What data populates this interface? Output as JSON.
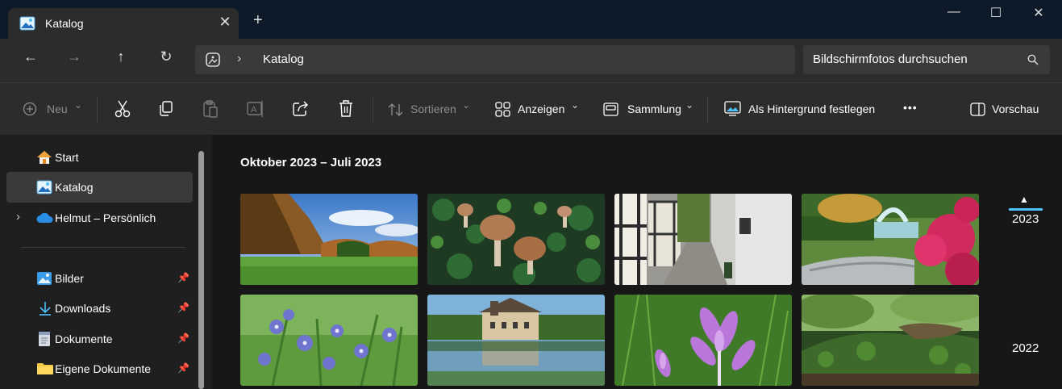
{
  "window": {
    "tab_title": "Katalog",
    "tab_close": "✕",
    "new_tab": "+",
    "minimize": "—",
    "maximize": "☐",
    "close": "✕"
  },
  "address": {
    "back": "←",
    "forward": "→",
    "up": "↑",
    "refresh": "↻",
    "separator": "›",
    "breadcrumb": "Katalog",
    "search_placeholder": "Bildschirmfotos durchsuchen",
    "search_icon": "search-icon"
  },
  "toolbar": {
    "new_label": "Neu",
    "sort_label": "Sortieren",
    "view_label": "Anzeigen",
    "collection_label": "Sammlung",
    "set_background_label": "Als Hintergrund festlegen",
    "more_label": "•••",
    "preview_label": "Vorschau",
    "chevron": "⌄"
  },
  "sidebar": {
    "items": [
      {
        "label": "Start",
        "icon": "home-icon"
      },
      {
        "label": "Katalog",
        "icon": "gallery-icon",
        "selected": true
      },
      {
        "label": "Helmut – Persönlich",
        "icon": "cloud-icon",
        "expander": "›"
      },
      {
        "label": "Bilder",
        "icon": "pictures-icon",
        "pin": "📌"
      },
      {
        "label": "Downloads",
        "icon": "download-icon",
        "pin": "📌"
      },
      {
        "label": "Dokumente",
        "icon": "documents-icon",
        "pin": "📌"
      },
      {
        "label": "Eigene Dokumente",
        "icon": "folder-icon",
        "pin": "📌"
      }
    ]
  },
  "main": {
    "group_title": "Oktober 2023 – Juli 2023",
    "timeline": {
      "arrow": "▲",
      "years": [
        "2023",
        "2022"
      ]
    },
    "photos": [
      {
        "subject": "autumn field with trees"
      },
      {
        "subject": "mushrooms"
      },
      {
        "subject": "half-timbered houses alley"
      },
      {
        "subject": "garden fountain with red maple"
      },
      {
        "subject": "blue borage flowers"
      },
      {
        "subject": "moated castle with reflection"
      },
      {
        "subject": "purple crocus flowers"
      },
      {
        "subject": "forest floor with ivy"
      }
    ]
  },
  "colors": {
    "accent": "#4cc2ff",
    "titlebar_bg": "#0d1a2a",
    "toolbar_bg": "#2c2c2c",
    "content_bg": "#171717"
  }
}
